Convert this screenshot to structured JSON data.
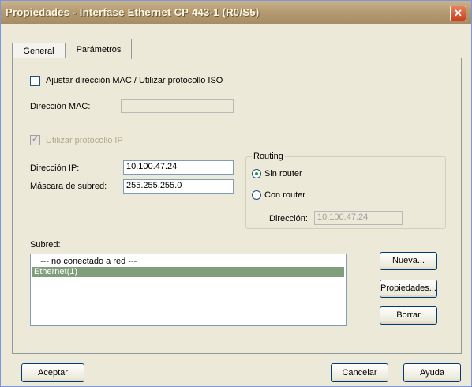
{
  "window": {
    "title": "Propiedades - Interfase Ethernet  CP 443-1 (R0/S5)",
    "close_glyph": "✕"
  },
  "tabs": [
    {
      "label": "General",
      "selected": false
    },
    {
      "label": "Parámetros",
      "selected": true
    }
  ],
  "mac_option": {
    "label": "Ajustar dirección MAC / Utilizar protocollo ISO",
    "checked": false
  },
  "mac_address": {
    "label": "Dirección MAC:",
    "value": ""
  },
  "ip_protocol": {
    "label": "Utilizar protocollo IP",
    "checked": true,
    "enabled": false
  },
  "ip_address": {
    "label": "Dirección IP:",
    "value": "10.100.47.24"
  },
  "subnet_mask": {
    "label": "Máscara de subred:",
    "value": "255.255.255.0"
  },
  "routing": {
    "title": "Routing",
    "option_no_router": "Sin router",
    "option_router": "Con router",
    "selected": "Sin router",
    "address_label": "Dirección:",
    "address_value": "10.100.47.24"
  },
  "subnet": {
    "label": "Subred:",
    "items": [
      "--- no conectado a red ---",
      "Ethernet(1)"
    ],
    "selected_index": 1
  },
  "side_buttons": {
    "new": "Nueva...",
    "properties": "Propiedades...",
    "delete": "Borrar"
  },
  "footer": {
    "ok": "Aceptar",
    "cancel": "Cancelar",
    "help": "Ayuda"
  }
}
